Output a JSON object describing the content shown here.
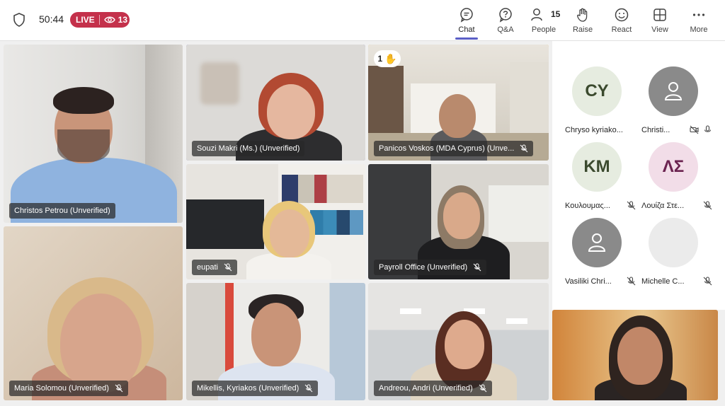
{
  "header": {
    "timer": "50:44",
    "live_label": "LIVE",
    "viewer_count": "13",
    "tools": [
      {
        "label": "Chat",
        "icon": "chat-icon",
        "active": true
      },
      {
        "label": "Q&A",
        "icon": "qa-icon"
      },
      {
        "label": "People",
        "icon": "people-icon",
        "count": "15"
      },
      {
        "label": "Raise",
        "icon": "raise-hand-icon"
      },
      {
        "label": "React",
        "icon": "react-icon"
      },
      {
        "label": "View",
        "icon": "view-icon"
      },
      {
        "label": "More",
        "icon": "more-icon"
      }
    ]
  },
  "tiles": [
    {
      "name": "Christos Petrou (Unverified)",
      "muted": false
    },
    {
      "name": "Souzi Makri (Ms.) (Unverified)",
      "muted": false,
      "highlight": "purple"
    },
    {
      "name": "Panicos Voskos (MDA Cyprus) (Unve...",
      "muted": true,
      "highlight": "gold",
      "raised_hands": "1"
    },
    {
      "name": "eupati",
      "muted": true
    },
    {
      "name": "Payroll Office (Unverified)",
      "muted": true
    },
    {
      "name": "Maria Solomou (Unverified)",
      "muted": true
    },
    {
      "name": "Mikellis, Kyriakos (Unverified)",
      "muted": true
    },
    {
      "name": "Andreou, Andri (Unverified)",
      "muted": true
    }
  ],
  "roster": [
    {
      "initials": "CY",
      "name": "Chryso kyriako...",
      "avatar_bg": "#e6ece0",
      "avatar_fg": "#3b4a2e"
    },
    {
      "initials": "",
      "name": "Christi...",
      "avatar_bg": "#8a8a8a",
      "icon": "person-icon",
      "video_off": true,
      "muted": false
    },
    {
      "initials": "KM",
      "name": "Κουλουμας...",
      "avatar_bg": "#e6ece0",
      "avatar_fg": "#3b4a2e",
      "muted": true
    },
    {
      "initials": "ΛΣ",
      "name": "Λουίζα Στε...",
      "avatar_bg": "#f2dde8",
      "avatar_fg": "#6b2350",
      "muted": true
    },
    {
      "initials": "",
      "name": "Vasiliki Chri...",
      "avatar_bg": "#8a8a8a",
      "icon": "person-icon",
      "muted": true
    },
    {
      "initials": "",
      "name": "Michelle C...",
      "avatar_bg": "#ebebeb",
      "muted": true
    }
  ]
}
